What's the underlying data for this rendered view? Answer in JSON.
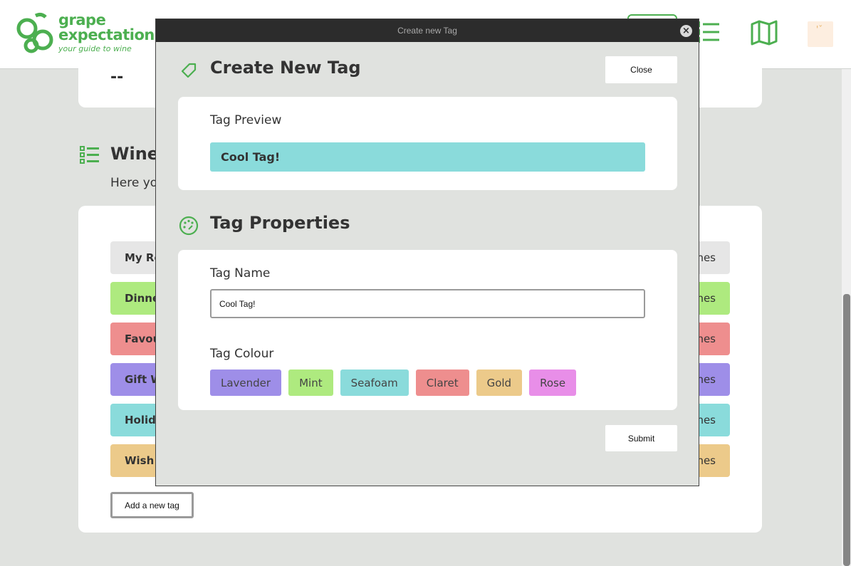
{
  "header": {
    "logo_line1": "grape",
    "logo_line2": "expectations",
    "logo_tagline": "your guide to wine",
    "brand_color": "#4caf50"
  },
  "background": {
    "top_card_value": "--",
    "section_heading": "Wine",
    "section_sub": "Here yo",
    "tag_rows": [
      {
        "label": "My Re",
        "right": "nes",
        "color": "#e6e6e6"
      },
      {
        "label": "Dinne",
        "right": "nes",
        "color": "#aeea7f"
      },
      {
        "label": "Favou",
        "right": "nes",
        "color": "#ee8e8e"
      },
      {
        "label": "Gift W",
        "right": "nes",
        "color": "#9e8ee8"
      },
      {
        "label": "Holida",
        "right": "nes",
        "color": "#8adbdb"
      },
      {
        "label": "Wish l",
        "right": "nes",
        "color": "#ecca8a"
      }
    ],
    "add_tag_label": "Add a new tag"
  },
  "modal": {
    "window_title": "Create new Tag",
    "heading": "Create New Tag",
    "close_label": "Close",
    "preview_label": "Tag Preview",
    "preview_tag_text": "Cool Tag!",
    "preview_color": "#8adbdb",
    "properties_heading": "Tag Properties",
    "name_label": "Tag Name",
    "name_value": "Cool Tag!",
    "colour_label": "Tag Colour",
    "colours": [
      {
        "name": "Lavender",
        "hex": "#9e8ee8"
      },
      {
        "name": "Mint",
        "hex": "#aeea7f"
      },
      {
        "name": "Seafoam",
        "hex": "#8adbdb"
      },
      {
        "name": "Claret",
        "hex": "#ee8e8e"
      },
      {
        "name": "Gold",
        "hex": "#ecca8a"
      },
      {
        "name": "Rose",
        "hex": "#e88ee8"
      }
    ],
    "submit_label": "Submit"
  }
}
